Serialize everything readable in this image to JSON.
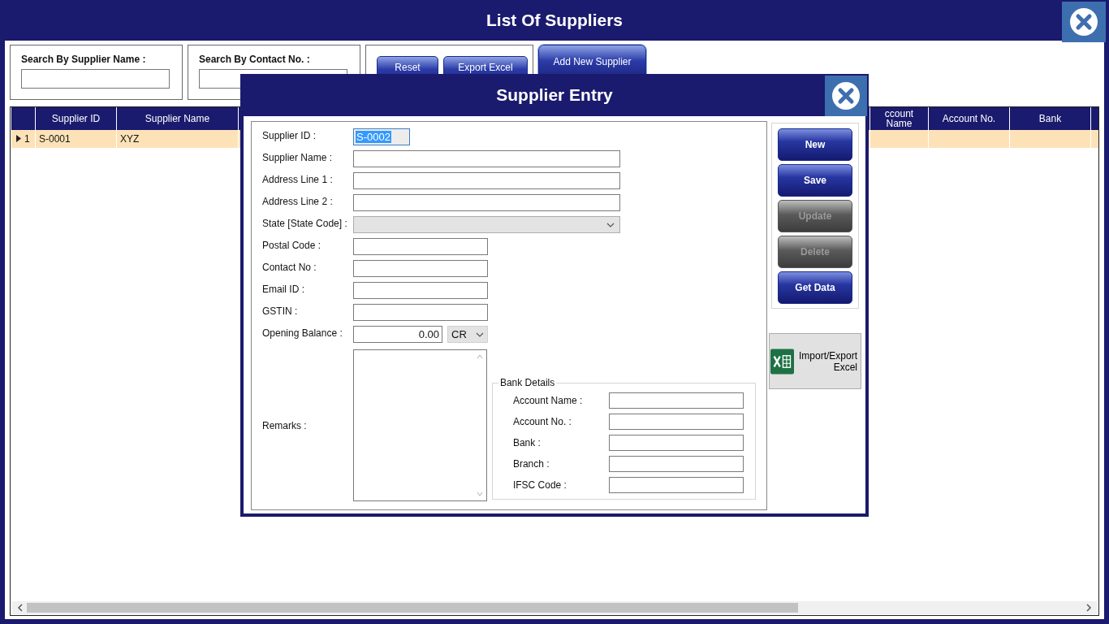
{
  "window": {
    "title": "List Of Suppliers"
  },
  "search_fields": [
    {
      "label": "Search By Supplier Name :"
    },
    {
      "label": "Search By Contact No. :"
    }
  ],
  "toolbar_buttons": [
    {
      "label": "Reset",
      "kind": "small"
    },
    {
      "label": "Export Excel",
      "kind": "small"
    },
    {
      "label": "Add New Supplier",
      "kind": "large"
    }
  ],
  "table": {
    "columns": [
      "Supplier ID",
      "Supplier Name",
      "ccount Name",
      "Account No.",
      "Bank"
    ],
    "rows": [
      {
        "number": "1",
        "selected": true,
        "cells": [
          "S-0001",
          "XYZ"
        ]
      }
    ]
  },
  "dialog": {
    "title": "Supplier Entry",
    "fields": [
      {
        "label": "Supplier ID :",
        "kind": "id",
        "value": "S-0002",
        "highlighted": true
      },
      {
        "label": "Supplier Name :",
        "kind": "wide"
      },
      {
        "label": "Address Line 1 :",
        "kind": "wide"
      },
      {
        "label": "Address Line 2 :",
        "kind": "wide"
      },
      {
        "label": "State [State Code] :",
        "kind": "select"
      },
      {
        "label": "Postal Code :",
        "kind": "short"
      },
      {
        "label": "Contact No :",
        "kind": "short"
      },
      {
        "label": "Email ID :",
        "kind": "short"
      },
      {
        "label": "GSTIN :",
        "kind": "short"
      },
      {
        "label": "Opening Balance :",
        "kind": "balance",
        "value": "0.00",
        "option": "CR"
      },
      {
        "label": "Remarks :",
        "kind": "textarea"
      }
    ],
    "bank_details": {
      "title": "Bank Details",
      "fields": [
        "Account Name :",
        "Account No. :",
        "Bank :",
        "Branch :",
        "IFSC Code :"
      ]
    },
    "actions": [
      {
        "label": "New",
        "disabled": false
      },
      {
        "label": "Save",
        "disabled": false
      },
      {
        "label": "Update",
        "disabled": true
      },
      {
        "label": "Delete",
        "disabled": true
      },
      {
        "label": "Get Data",
        "disabled": false
      }
    ],
    "import_button": {
      "label": "Import/Export Excel"
    }
  }
}
